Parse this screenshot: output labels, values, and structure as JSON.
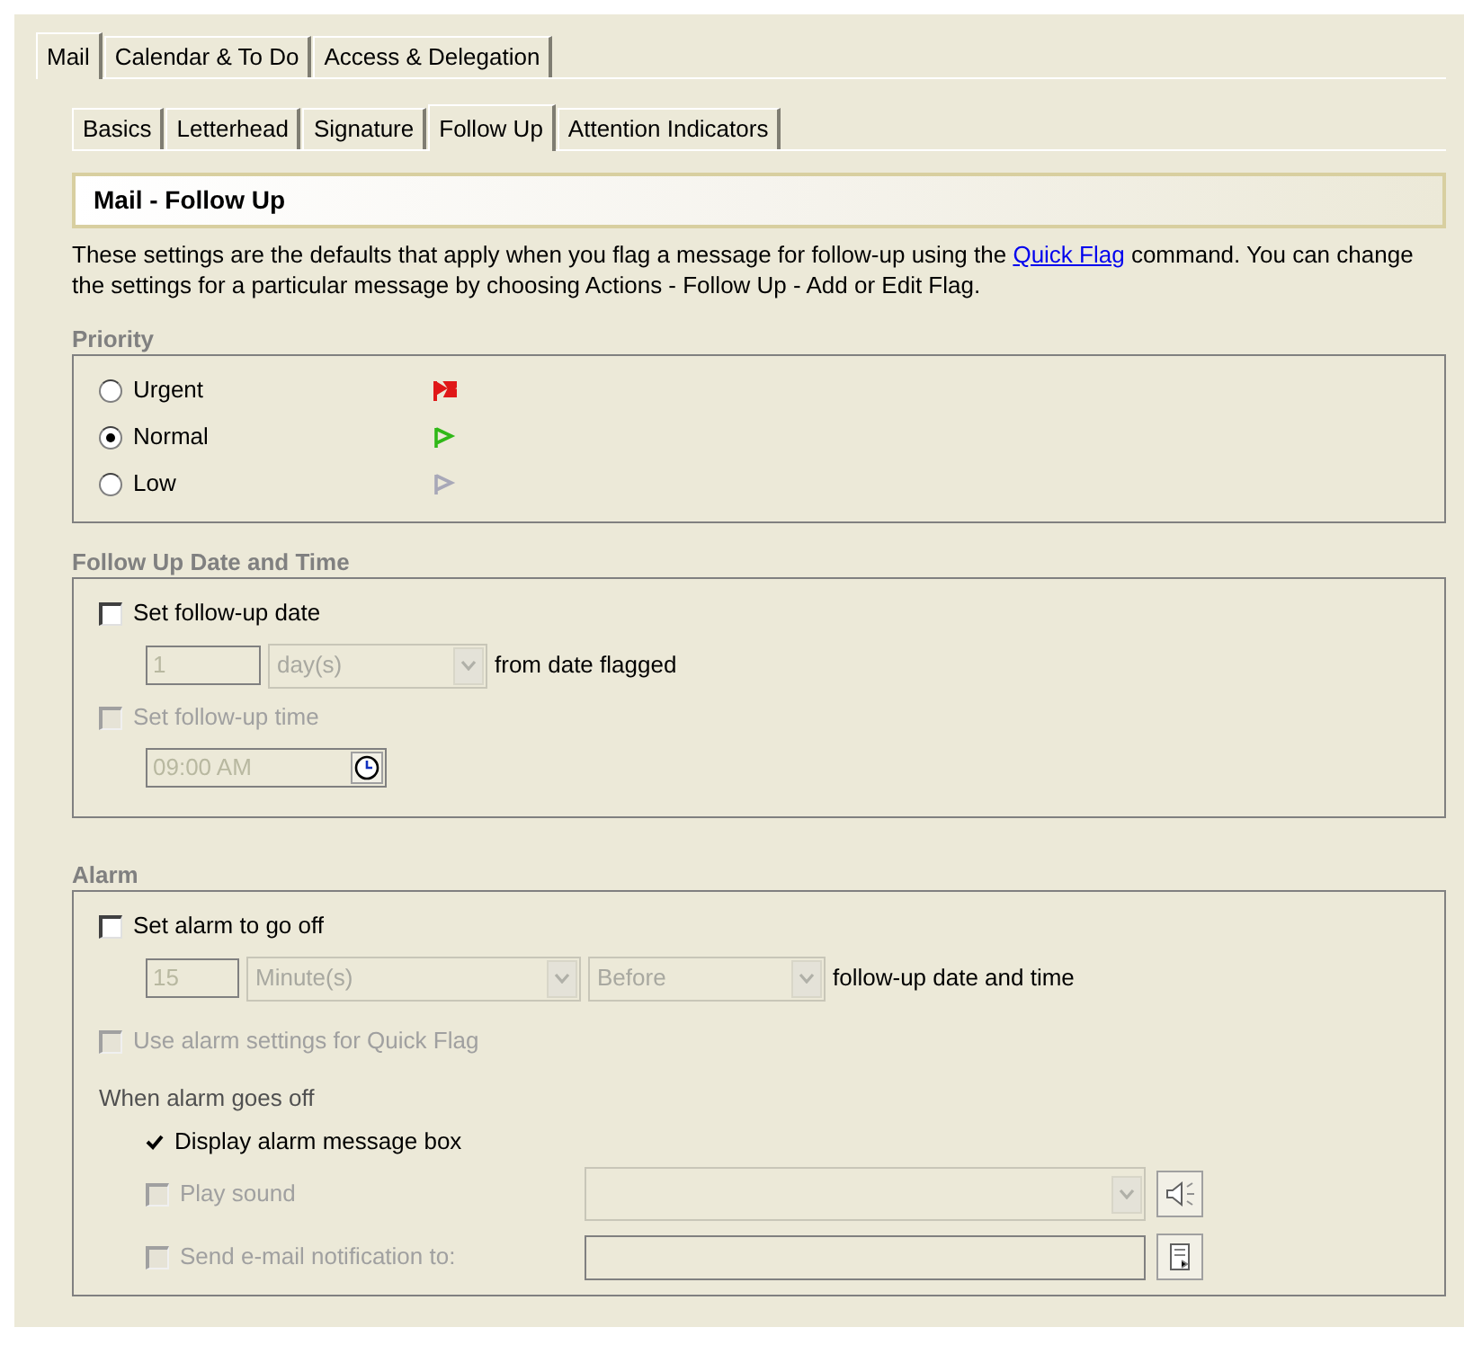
{
  "main_tabs": [
    {
      "label": "Mail",
      "selected": true
    },
    {
      "label": "Calendar & To Do",
      "selected": false
    },
    {
      "label": "Access & Delegation",
      "selected": false
    }
  ],
  "sub_tabs": [
    {
      "label": "Basics",
      "selected": false
    },
    {
      "label": "Letterhead",
      "selected": false
    },
    {
      "label": "Signature",
      "selected": false
    },
    {
      "label": "Follow Up",
      "selected": true
    },
    {
      "label": "Attention Indicators",
      "selected": false
    }
  ],
  "section_title": "Mail - Follow Up",
  "description": {
    "before": "These settings are the defaults that apply when you flag a message for follow-up using the",
    "link": "Quick Flag",
    "after": "command.  You can change the settings for a particular message by choosing Actions - Follow Up - Add or Edit Flag."
  },
  "priority": {
    "title": "Priority",
    "options": [
      {
        "label": "Urgent",
        "selected": false,
        "color": "#e01818",
        "kind": "double"
      },
      {
        "label": "Normal",
        "selected": true,
        "color": "#30b818",
        "kind": "single"
      },
      {
        "label": "Low",
        "selected": false,
        "color": "#a8a8b8",
        "kind": "single"
      }
    ]
  },
  "follow_up": {
    "title": "Follow Up Date and Time",
    "set_date": {
      "label": "Set follow-up date",
      "checked": false,
      "disabled": false
    },
    "amount": {
      "value": "1",
      "disabled": true
    },
    "unit": {
      "value": "day(s)",
      "disabled": true
    },
    "suffix": "from date flagged",
    "set_time": {
      "label": "Set follow-up time",
      "checked": false,
      "disabled": true
    },
    "time": {
      "value": "09:00 AM",
      "disabled": true
    }
  },
  "alarm": {
    "title": "Alarm",
    "set_alarm": {
      "label": "Set alarm to go off",
      "checked": false,
      "disabled": false
    },
    "amount": {
      "value": "15",
      "disabled": true
    },
    "unit": {
      "value": "Minute(s)",
      "disabled": true
    },
    "relation": {
      "value": "Before",
      "disabled": true
    },
    "suffix": "follow-up date and time",
    "use_quick": {
      "label": "Use alarm settings for Quick Flag",
      "checked": false,
      "disabled": true
    },
    "when_label": "When alarm goes off",
    "display_box": {
      "label": "Display alarm message box",
      "checked": true
    },
    "play_sound": {
      "label": "Play sound",
      "checked": false,
      "disabled": true
    },
    "sound_select": {
      "disabled": true
    },
    "send_email": {
      "label": "Send e-mail notification to:",
      "checked": false,
      "disabled": true
    },
    "email_field": {
      "disabled": true
    }
  }
}
